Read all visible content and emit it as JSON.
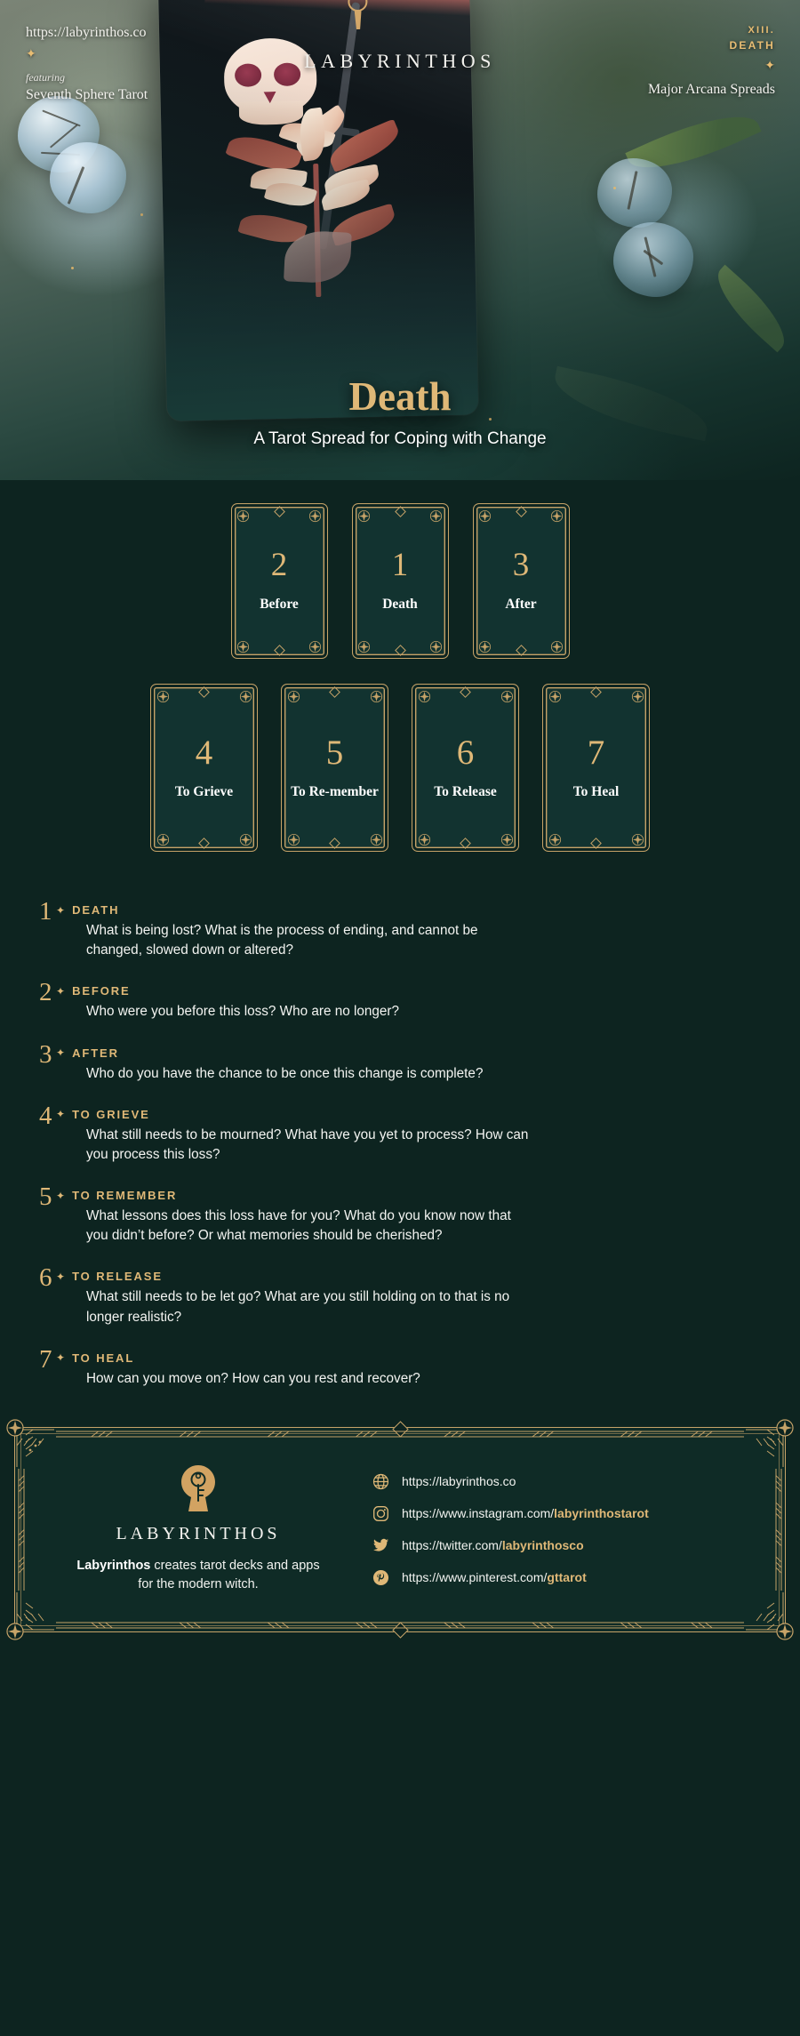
{
  "hero": {
    "url": "https://labyrinthos.co",
    "featuring_label": "featuring",
    "deck_name": "Seventh Sphere Tarot",
    "wordmark": "LABYRINTHOS",
    "arcana_number": "XIII.",
    "arcana_name": "DEATH",
    "series": "Major Arcana Spreads",
    "title": "Death",
    "tagline": "A Tarot Spread for Coping with Change",
    "star_glyph": "✦"
  },
  "spread": {
    "row1": [
      {
        "number": "2",
        "label": "Before"
      },
      {
        "number": "1",
        "label": "Death"
      },
      {
        "number": "3",
        "label": "After"
      }
    ],
    "row2": [
      {
        "number": "4",
        "label": "To Grieve"
      },
      {
        "number": "5",
        "label": "To Re-member"
      },
      {
        "number": "6",
        "label": "To Release"
      },
      {
        "number": "7",
        "label": "To Heal"
      }
    ]
  },
  "descriptions": [
    {
      "number": "1",
      "star": "✦",
      "label": "DEATH",
      "text": "What is being lost? What is the process of ending, and cannot be changed, slowed down or altered?"
    },
    {
      "number": "2",
      "star": "✦",
      "label": "BEFORE",
      "text": "Who were you before this loss? Who are no longer?"
    },
    {
      "number": "3",
      "star": "✦",
      "label": "AFTER",
      "text": "Who do you have the chance to be once this change is complete?"
    },
    {
      "number": "4",
      "star": "✦",
      "label": "TO GRIEVE",
      "text": "What still needs to be mourned? What have you yet to process? How can you process this loss?"
    },
    {
      "number": "5",
      "star": "✦",
      "label": "TO REMEMBER",
      "text": "What lessons does this loss have for you? What do you know now that you didn’t before? Or what memories should be cherished?"
    },
    {
      "number": "6",
      "star": "✦",
      "label": "TO RELEASE",
      "text": "What still needs to be let go? What are you still holding on to that is no longer realistic?"
    },
    {
      "number": "7",
      "star": "✦",
      "label": "TO HEAL",
      "text": "How can you move on? How can you rest and recover?"
    }
  ],
  "footer": {
    "brand": "LABYRINTHOS",
    "tagline_strong": "Labyrinthos",
    "tagline_rest": " creates tarot decks and apps for the modern witch.",
    "links": [
      {
        "icon": "globe-icon",
        "prefix": "https://labyrinthos.co",
        "handle": ""
      },
      {
        "icon": "instagram-icon",
        "prefix": "https://www.instagram.com/",
        "handle": "labyrinthostarot"
      },
      {
        "icon": "twitter-icon",
        "prefix": "https://twitter.com/",
        "handle": "labyrinthosco"
      },
      {
        "icon": "pinterest-icon",
        "prefix": "https://www.pinterest.com/",
        "handle": "gttarot"
      }
    ]
  },
  "colors": {
    "gold": "#dfb877",
    "gold_line": "#c6a368",
    "bg_dark": "#0d2420",
    "card_bg": "#123330",
    "text_white": "#f3f4f1"
  }
}
